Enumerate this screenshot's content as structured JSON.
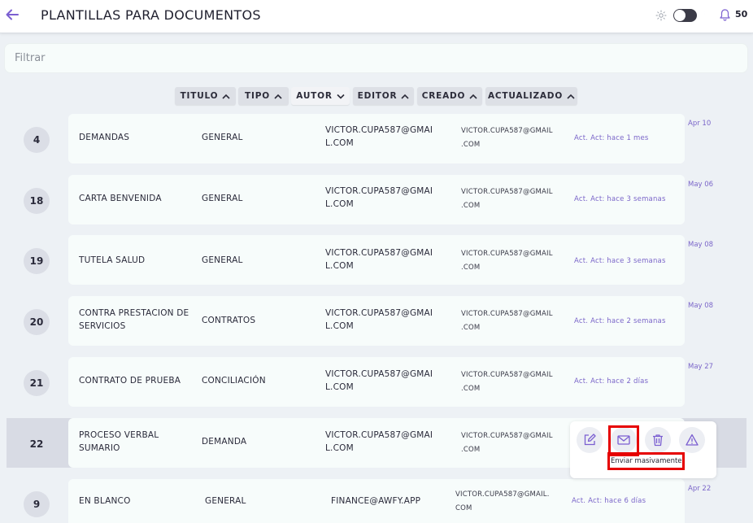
{
  "header": {
    "title": "PLANTILLAS PARA DOCUMENTOS",
    "notification_count": "50"
  },
  "filter": {
    "placeholder": "Filtrar"
  },
  "sort_chips": [
    {
      "label": "TITULO",
      "direction": "up"
    },
    {
      "label": "TIPO",
      "direction": "up"
    },
    {
      "label": "AUTOR",
      "direction": "down",
      "active": true
    },
    {
      "label": "EDITOR",
      "direction": "up"
    },
    {
      "label": "CREADO",
      "direction": "up"
    },
    {
      "label": "ACTUALIZADO",
      "direction": "up"
    }
  ],
  "rows": [
    {
      "num": "4",
      "title_1": "DEMANDAS",
      "title_2": "",
      "type": "GENERAL",
      "author_1": "VICTOR.CUPA587@GMAI",
      "author_2": "L.COM",
      "editor_1": "VICTOR.CUPA587@GMAIL",
      "editor_2": ".COM",
      "updated": "Act. Act: hace 1 mes",
      "date": "Apr 10"
    },
    {
      "num": "18",
      "title_1": "CARTA BENVENIDA",
      "title_2": "",
      "type": "GENERAL",
      "author_1": "VICTOR.CUPA587@GMAI",
      "author_2": "L.COM",
      "editor_1": "VICTOR.CUPA587@GMAIL",
      "editor_2": ".COM",
      "updated": "Act. Act: hace 3 semanas",
      "date": "May 06"
    },
    {
      "num": "19",
      "title_1": "TUTELA SALUD",
      "title_2": "",
      "type": "GENERAL",
      "author_1": "VICTOR.CUPA587@GMAI",
      "author_2": "L.COM",
      "editor_1": "VICTOR.CUPA587@GMAIL",
      "editor_2": ".COM",
      "updated": "Act. Act: hace 3 semanas",
      "date": "May 08"
    },
    {
      "num": "20",
      "title_1": "CONTRA PRESTACION DE",
      "title_2": "SERVICIOS",
      "type": "CONTRATOS",
      "author_1": "VICTOR.CUPA587@GMAI",
      "author_2": "L.COM",
      "editor_1": "VICTOR.CUPA587@GMAIL",
      "editor_2": ".COM",
      "updated": "Act. Act: hace 2 semanas",
      "date": "May 08"
    },
    {
      "num": "21",
      "title_1": "CONTRATO DE PRUEBA",
      "title_2": "",
      "type": "CONCILIACIÓN",
      "author_1": "VICTOR.CUPA587@GMAI",
      "author_2": "L.COM",
      "editor_1": "VICTOR.CUPA587@GMAIL",
      "editor_2": ".COM",
      "updated": "Act. Act: hace 2 días",
      "date": "May 27"
    },
    {
      "num": "22",
      "title_1": "PROCESO VERBAL",
      "title_2": "SUMARIO",
      "type": "DEMANDA",
      "author_1": "VICTOR.CUPA587@GMAI",
      "author_2": "L.COM",
      "editor_1": "VICTOR.CUPA587@GMAIL",
      "editor_2": ".COM",
      "updated": "",
      "date": ""
    },
    {
      "num": "9",
      "title_1": "EN BLANCO",
      "title_2": "",
      "type": "GENERAL",
      "author_1": "FINANCE@AWFY.APP",
      "author_2": "",
      "editor_1": "VICTOR.CUPA587@GMAIL.",
      "editor_2": "COM",
      "updated": "Act. Act: hace 6 días",
      "date": "Apr 22"
    }
  ],
  "actions": {
    "tooltip": "Enviar masivamente",
    "icons": [
      "edit-icon",
      "mail-icon",
      "trash-icon",
      "warning-icon"
    ]
  },
  "colors": {
    "accent": "#7b66c9",
    "highlight": "#e60000",
    "card": "#f7fcfb",
    "background": "#edf1f5"
  }
}
